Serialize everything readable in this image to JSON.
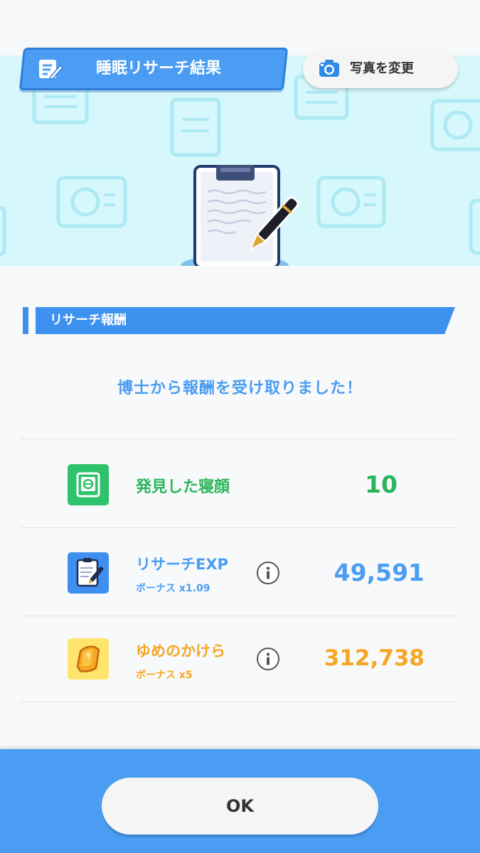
{
  "header": {
    "title": "睡眠リサーチ結果",
    "photo_button_label": "写真を変更"
  },
  "section": {
    "title": "リサーチ報酬"
  },
  "message": "博士から報酬を受け取りました！",
  "rewards": [
    {
      "icon": "sleep-style-icon",
      "label": "発見した寝顔",
      "sub": "",
      "value": "10",
      "color": "#2ab55a"
    },
    {
      "icon": "research-exp-icon",
      "label": "リサーチEXP",
      "sub": "ボーナス x1.09",
      "value": "49,591",
      "color": "#4a9df2"
    },
    {
      "icon": "dream-shards-icon",
      "label": "ゆめのかけら",
      "sub": "ボーナス x5",
      "value": "312,738",
      "color": "#f5a623"
    }
  ],
  "footer": {
    "ok_label": "OK"
  },
  "colors": {
    "accent_blue": "#4a9df2",
    "hero_bg": "#d6f7fb",
    "green": "#2ab55a",
    "orange": "#f5a623"
  }
}
